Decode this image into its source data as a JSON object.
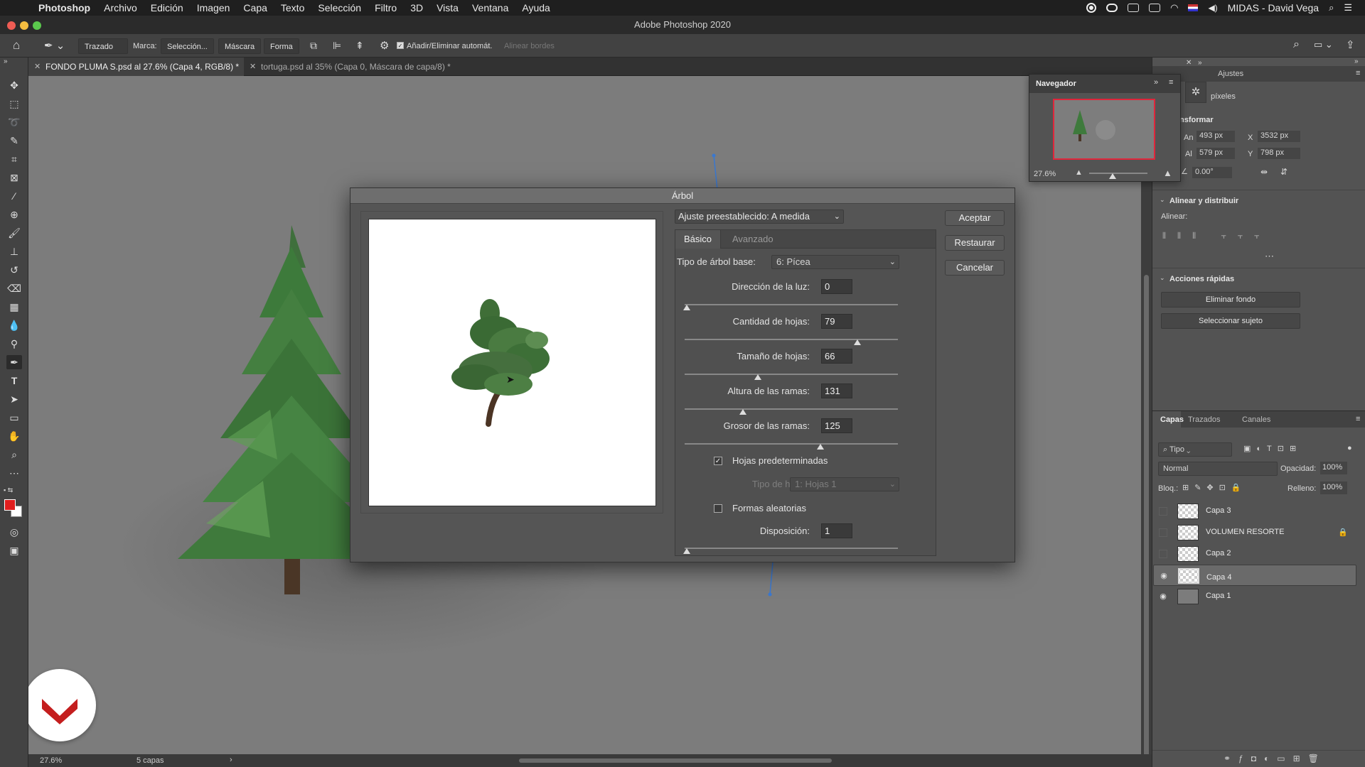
{
  "menubar": {
    "app": "Photoshop",
    "items": [
      "Archivo",
      "Edición",
      "Imagen",
      "Capa",
      "Texto",
      "Selección",
      "Filtro",
      "3D",
      "Vista",
      "Ventana",
      "Ayuda"
    ],
    "user": "MIDAS - David Vega"
  },
  "window": {
    "title": "Adobe Photoshop 2020"
  },
  "options": {
    "mode": "Trazado",
    "marca_label": "Marca:",
    "seleccion": "Selección...",
    "mascara": "Máscara",
    "forma": "Forma",
    "auto_add": "Añadir/Eliminar automát.",
    "align_edges": "Alinear bordes"
  },
  "tabs": [
    {
      "label": "FONDO PLUMA S.psd al 27.6% (Capa 4, RGB/8) *"
    },
    {
      "label": "tortuga.psd al 35% (Capa 0, Máscara de capa/8) *"
    }
  ],
  "status": {
    "zoom": "27.6%",
    "layers": "5 capas"
  },
  "navigator": {
    "title": "Navegador",
    "zoom": "27.6%"
  },
  "properties": {
    "tab": "Ajustes",
    "pixels": "píxeles",
    "transform_title": "nsformar",
    "w_label": "An",
    "w": "493 px",
    "x_label": "X",
    "x": "3532 px",
    "h_label": "Al",
    "h": "579 px",
    "y_label": "Y",
    "y": "798 px",
    "angle": "0.00°",
    "align_title": "Alinear y distribuir",
    "align_label": "Alinear:",
    "quick_title": "Acciones rápidas",
    "remove_bg": "Eliminar fondo",
    "select_subject": "Seleccionar sujeto"
  },
  "layers_panel": {
    "tabs": [
      "Capas",
      "Trazados",
      "Canales"
    ],
    "filter": "Tipo",
    "blend": "Normal",
    "opacity_label": "Opacidad:",
    "opacity": "100%",
    "lock_label": "Bloq.:",
    "fill_label": "Relleno:",
    "fill": "100%",
    "layers": [
      {
        "name": "Capa 3",
        "visible": false
      },
      {
        "name": "VOLUMEN RESORTE",
        "visible": false
      },
      {
        "name": "Capa 2",
        "visible": false
      },
      {
        "name": "Capa 4",
        "visible": true
      },
      {
        "name": "Capa 1",
        "visible": true
      }
    ]
  },
  "dialog": {
    "title": "Árbol",
    "preset": "Ajuste preestablecido: A medida",
    "tabs": [
      "Básico",
      "Avanzado"
    ],
    "tree_type_label": "Tipo de árbol base:",
    "tree_type": "6: Pícea",
    "light_label": "Dirección de la luz:",
    "light": "0",
    "leaves_amount_label": "Cantidad de hojas:",
    "leaves_amount": "79",
    "leaves_size_label": "Tamaño de hojas:",
    "leaves_size": "66",
    "branch_height_label": "Altura de las ramas:",
    "branch_height": "131",
    "branch_thickness_label": "Grosor de las ramas:",
    "branch_thickness": "125",
    "default_leaves_label": "Hojas predeterminadas",
    "leaf_type_label": "Tipo de hojas:",
    "leaf_type": "1: Hojas 1",
    "random_label": "Formas aleatorias",
    "arrangement_label": "Disposición:",
    "arrangement": "1",
    "ok": "Aceptar",
    "reset": "Restaurar",
    "cancel": "Cancelar"
  },
  "colors": {
    "accent": "#e01e1e",
    "tree_green": "#3e7a3c",
    "navigator_frame": "#e0263b"
  }
}
